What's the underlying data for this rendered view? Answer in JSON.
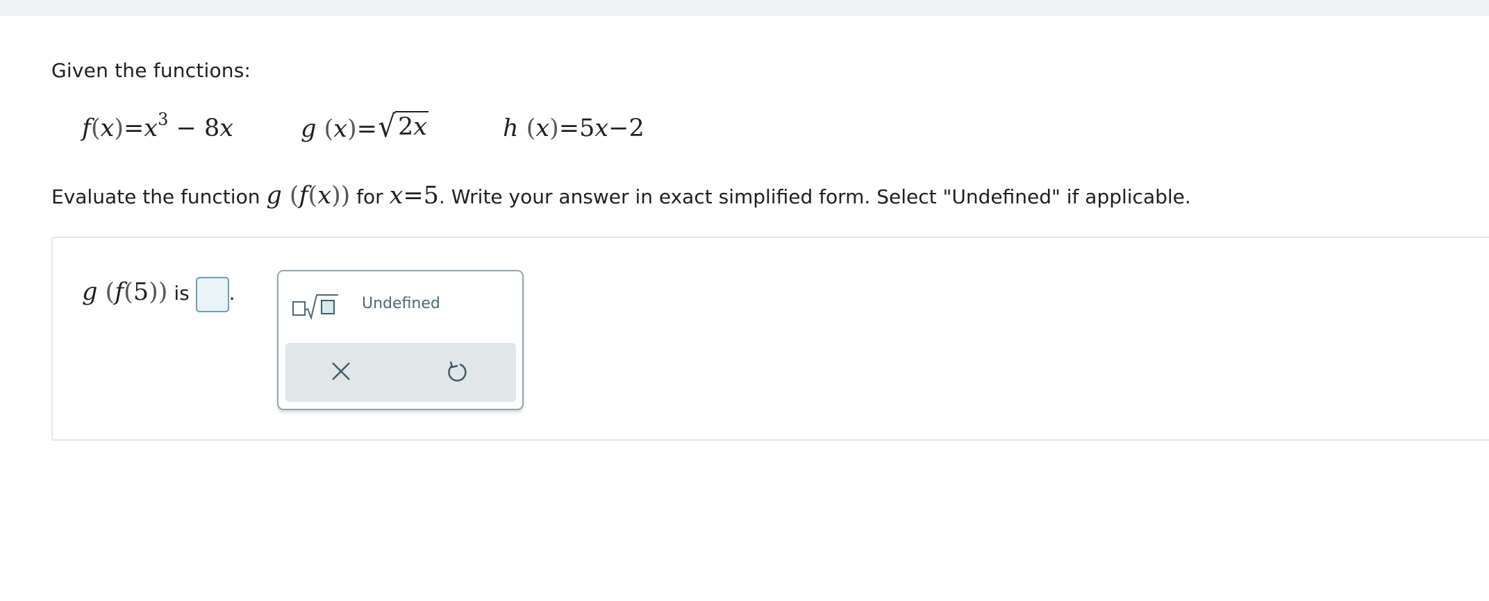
{
  "header": {
    "bar": ""
  },
  "intro": "Given the functions:",
  "functions": {
    "f": {
      "name": "f",
      "var": "x",
      "eq": "=",
      "term1": "x",
      "exp": "3",
      "op": "−",
      "coef": "8",
      "v2": "x"
    },
    "g": {
      "name": "g",
      "var": "x",
      "eq": "=",
      "radicand_coef": "2",
      "radicand_var": "x"
    },
    "h": {
      "name": "h",
      "var": "x",
      "eq": "=",
      "coef": "5",
      "v2": "x",
      "op": "−",
      "const": "2"
    }
  },
  "question": {
    "prefix": "Evaluate the function",
    "outer": "g",
    "inner": "f",
    "var": "x",
    "mid": "for",
    "cond_var": "x",
    "cond_eq": "=",
    "cond_val": "5",
    "suffix": ". Write your answer in exact simplified form. Select \"Undefined\" if applicable."
  },
  "answer": {
    "outer": "g",
    "inner": "f",
    "arg": "5",
    "is_label": "is",
    "period": "."
  },
  "palette": {
    "undefined_label": "Undefined"
  },
  "icons": {
    "sqrt": "sqrt-template-icon",
    "clear": "close-icon",
    "undo": "undo-icon"
  },
  "colors": {
    "input_border": "#6a9fb5",
    "input_bg": "#e9f4f6",
    "palette_border": "#8fa5ae",
    "control_bar": "#e1e6e9",
    "icon": "#3f5b67"
  }
}
